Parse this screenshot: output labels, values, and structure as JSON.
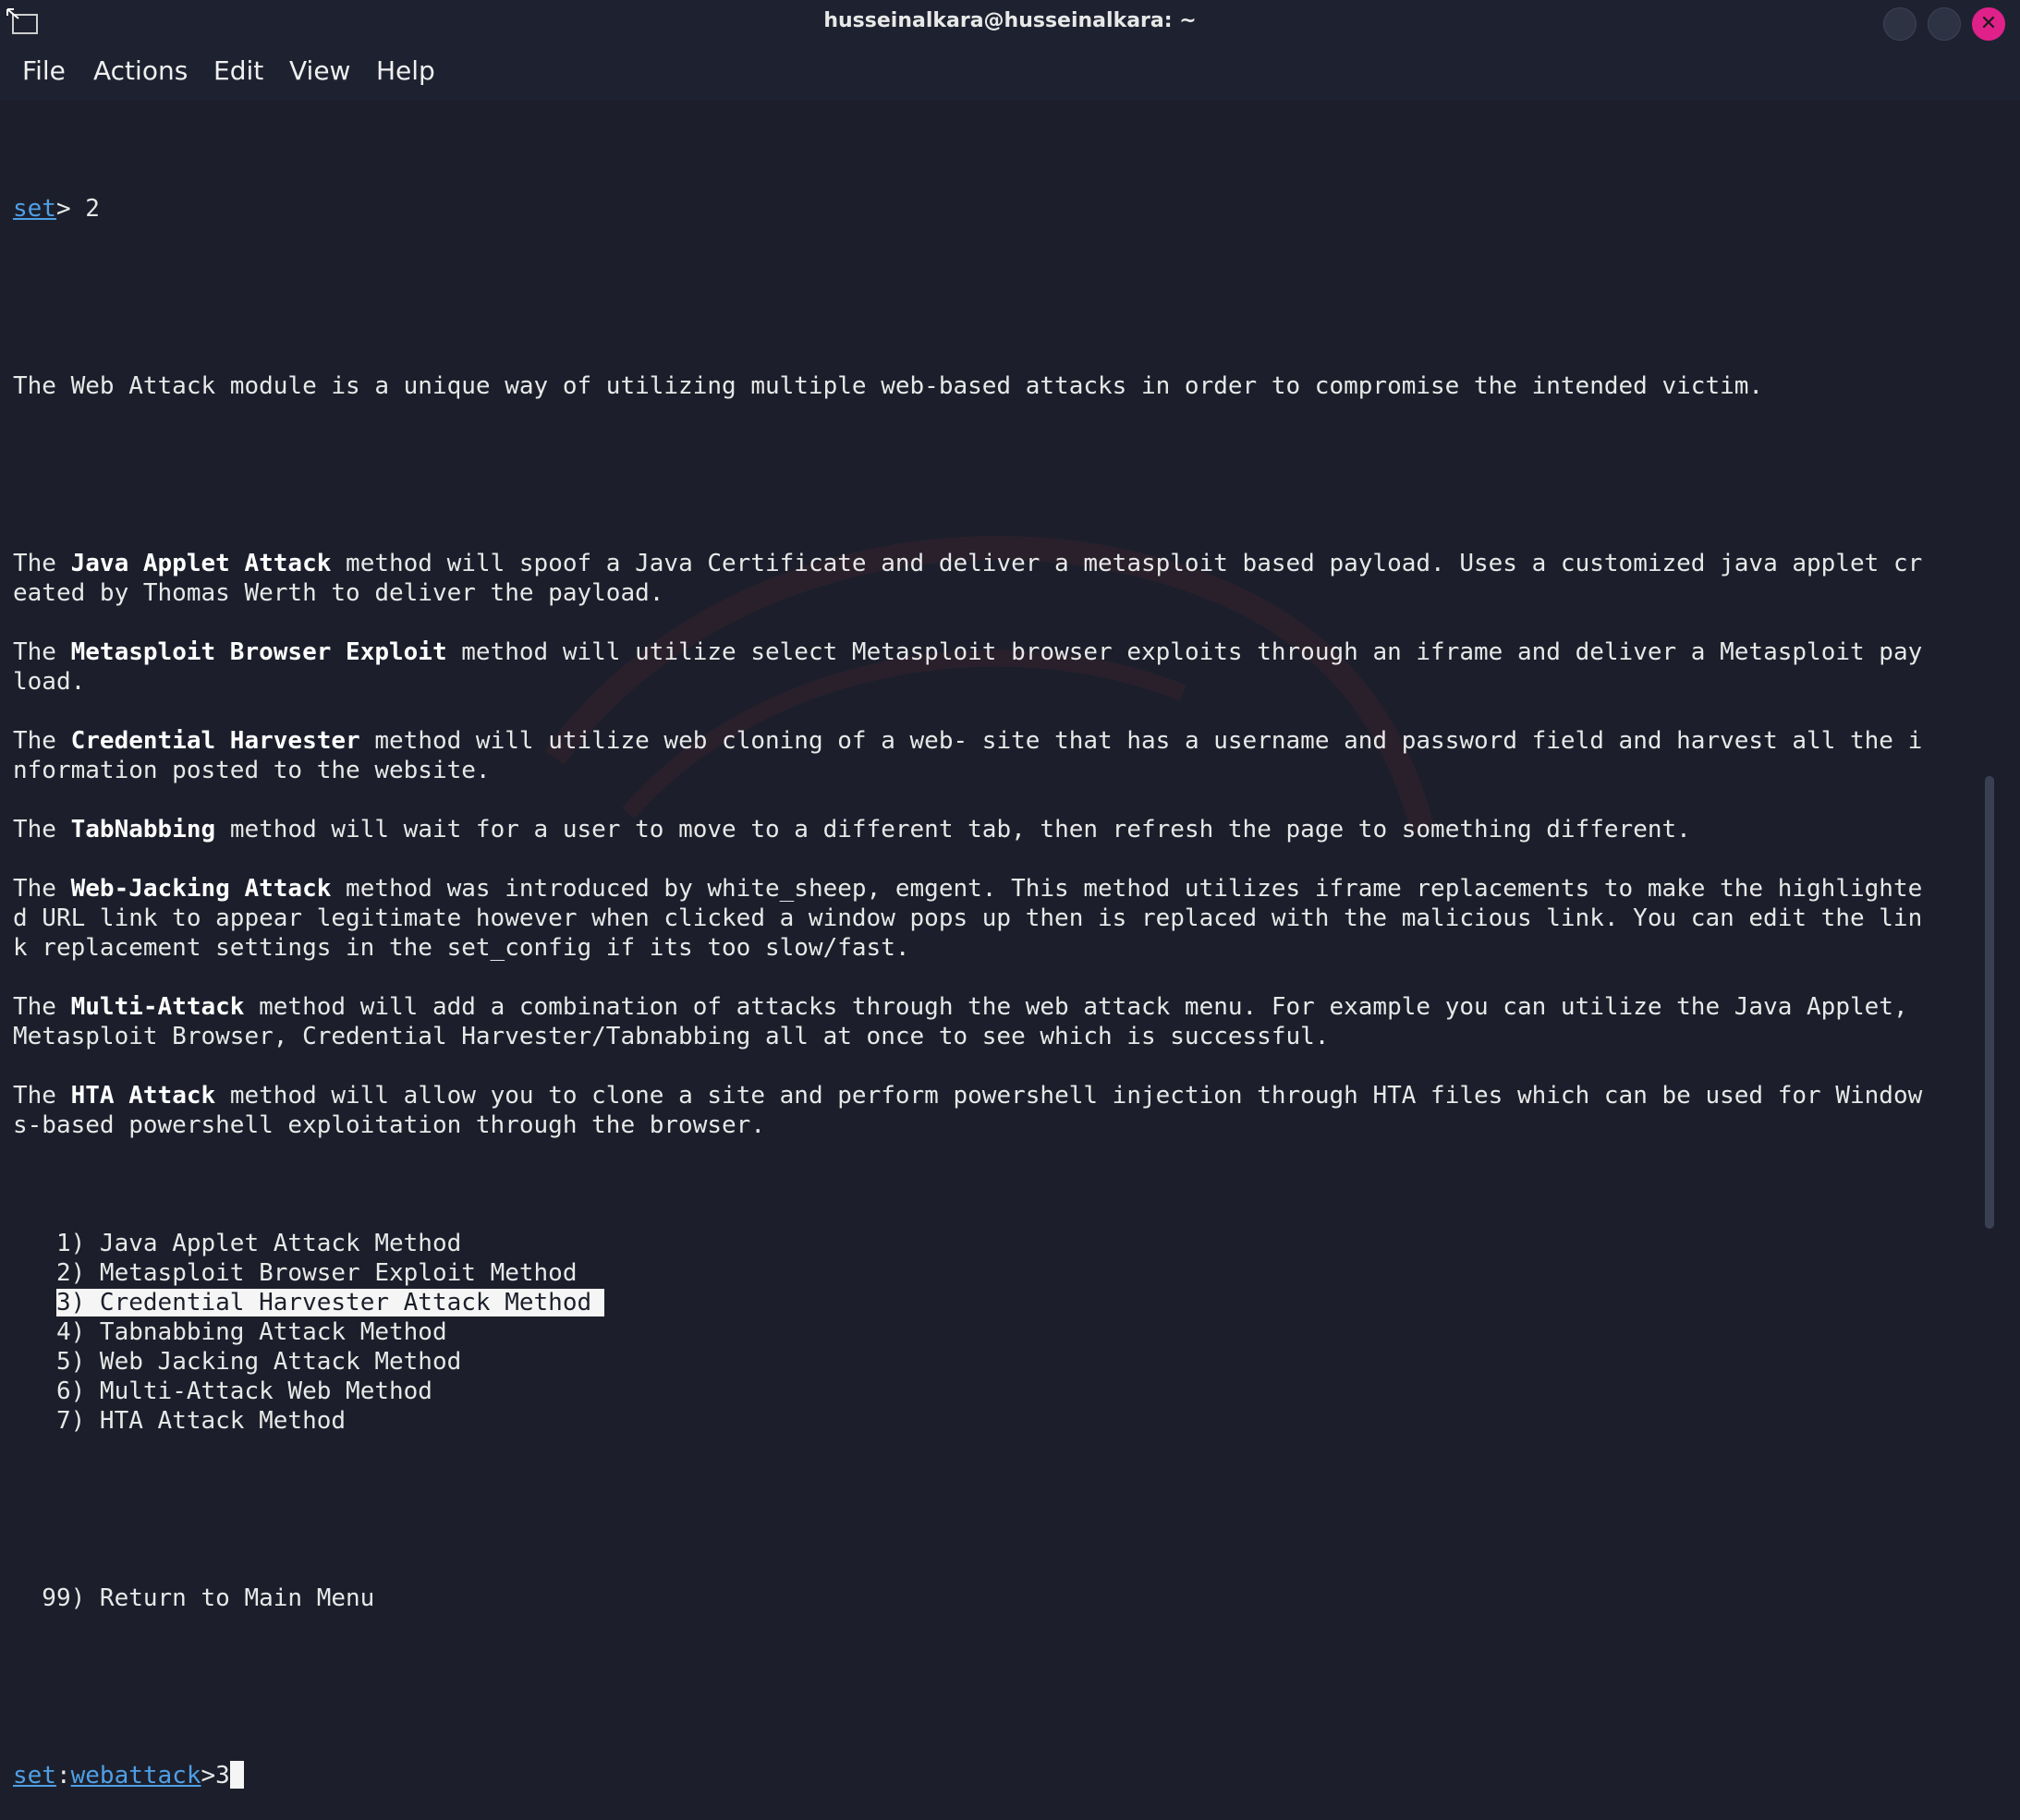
{
  "window": {
    "title": "husseinalkara@husseinalkara: ~"
  },
  "menu": [
    "File",
    "Actions",
    "Edit",
    "View",
    "Help"
  ],
  "colors": {
    "background": "#1c1f2b",
    "prompt_link": "#4f9fe6",
    "close_button": "#e0218a",
    "text": "#e8e8e8"
  },
  "terminal": {
    "prompt1": {
      "link": "set",
      "rest": "> 2"
    },
    "intro": "The Web Attack module is a unique way of utilizing multiple web-based attacks in order to compromise the intended victim.",
    "paragraphs": [
      {
        "pre": "The ",
        "bold": "Java Applet Attack",
        "line1": " method will spoof a Java Certificate and deliver a metasploit based payload. Uses a customized java applet cr",
        "more": [
          "eated by Thomas Werth to deliver the payload."
        ]
      },
      {
        "pre": "The ",
        "bold": "Metasploit Browser Exploit",
        "line1": " method will utilize select Metasploit browser exploits through an iframe and deliver a Metasploit pay",
        "more": [
          "load."
        ]
      },
      {
        "pre": "The ",
        "bold": "Credential Harvester",
        "line1": " method will utilize web cloning of a web- site that has a username and password field and harvest all the i",
        "more": [
          "nformation posted to the website."
        ]
      },
      {
        "pre": "The ",
        "bold": "TabNabbing",
        "line1": " method will wait for a user to move to a different tab, then refresh the page to something different.",
        "more": []
      },
      {
        "pre": "The ",
        "bold": "Web-Jacking Attack",
        "line1": " method was introduced by white_sheep, emgent. This method utilizes iframe replacements to make the highlighte",
        "more": [
          "d URL link to appear legitimate however when clicked a window pops up then is replaced with the malicious link. You can edit the lin",
          "k replacement settings in the set_config if its too slow/fast."
        ]
      },
      {
        "pre": "The ",
        "bold": "Multi-Attack",
        "line1": " method will add a combination of attacks through the web attack menu. For example you can utilize the Java Applet,",
        "more": [
          "Metasploit Browser, Credential Harvester/Tabnabbing all at once to see which is successful."
        ]
      },
      {
        "pre": "The ",
        "bold": "HTA Attack",
        "line1": " method will allow you to clone a site and perform powershell injection through HTA files which can be used for Window",
        "more": [
          "s-based powershell exploitation through the browser."
        ]
      }
    ],
    "options": [
      {
        "text": "   1) Java Applet Attack Method",
        "selected": false
      },
      {
        "text": "   2) Metasploit Browser Exploit Method",
        "selected": false
      },
      {
        "text": "   3) Credential Harvester Attack Method",
        "selected": true
      },
      {
        "text": "   4) Tabnabbing Attack Method",
        "selected": false
      },
      {
        "text": "   5) Web Jacking Attack Method",
        "selected": false
      },
      {
        "text": "   6) Multi-Attack Web Method",
        "selected": false
      },
      {
        "text": "   7) HTA Attack Method",
        "selected": false
      }
    ],
    "return_option": "  99) Return to Main Menu",
    "prompt2": {
      "link1": "set",
      "sep": ":",
      "link2": "webattack",
      "rest": ">3"
    }
  }
}
